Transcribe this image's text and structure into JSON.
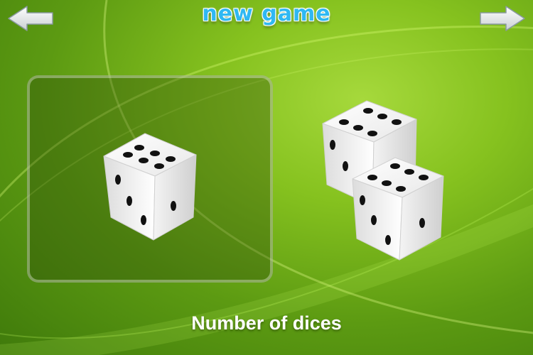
{
  "header": {
    "title": "new game",
    "back_icon": "arrow-left-icon",
    "forward_icon": "arrow-right-icon"
  },
  "options": [
    {
      "dice_count": 1,
      "selected": true
    },
    {
      "dice_count": 2,
      "selected": false
    }
  ],
  "footer": {
    "caption": "Number of dices"
  },
  "colors": {
    "background": "#86c21f",
    "title": "#2fb8f2",
    "caption": "#ffffff"
  }
}
